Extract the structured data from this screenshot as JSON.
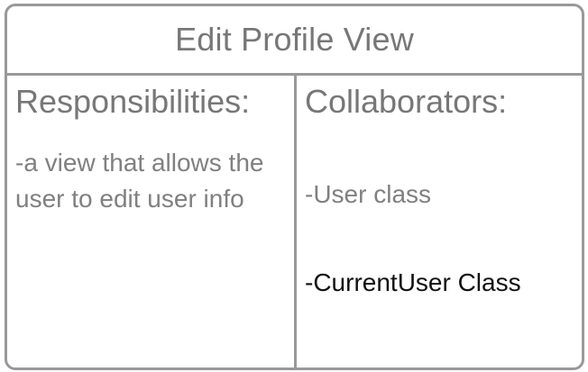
{
  "card": {
    "title": "Edit Profile View",
    "responsibilities": {
      "heading": "Responsibilities:",
      "items": [
        "-a view that allows the user to edit user info"
      ]
    },
    "collaborators": {
      "heading": "Collaborators:",
      "items": [
        "-User class",
        "-CurrentUser Class"
      ]
    }
  },
  "colors": {
    "border": "#999999",
    "muted_text": "#777777",
    "body_text": "#808080",
    "highlight_text": "#111111"
  }
}
